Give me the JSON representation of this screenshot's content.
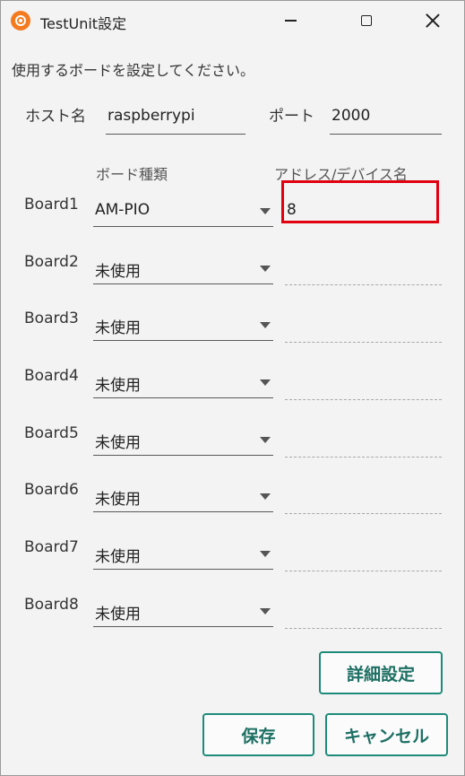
{
  "window": {
    "title": "TestUnit設定",
    "icon": "app-target-icon"
  },
  "instruction": "使用するボードを設定してください。",
  "host": {
    "label": "ホスト名",
    "value": "raspberrypi"
  },
  "port": {
    "label": "ポート",
    "value": "2000"
  },
  "headers": {
    "board_type": "ボード種類",
    "address": "アドレス/デバイス名"
  },
  "boards": [
    {
      "label": "Board1",
      "type": "AM-PIO",
      "address": "8"
    },
    {
      "label": "Board2",
      "type": "未使用",
      "address": ""
    },
    {
      "label": "Board3",
      "type": "未使用",
      "address": ""
    },
    {
      "label": "Board4",
      "type": "未使用",
      "address": ""
    },
    {
      "label": "Board5",
      "type": "未使用",
      "address": ""
    },
    {
      "label": "Board6",
      "type": "未使用",
      "address": ""
    },
    {
      "label": "Board7",
      "type": "未使用",
      "address": ""
    },
    {
      "label": "Board8",
      "type": "未使用",
      "address": ""
    }
  ],
  "buttons": {
    "detail": "詳細設定",
    "save": "保存",
    "cancel": "キャンセル"
  },
  "colors": {
    "accent": "#1d8b7a",
    "highlight": "#e0000f",
    "app_icon": "#f47a20"
  }
}
